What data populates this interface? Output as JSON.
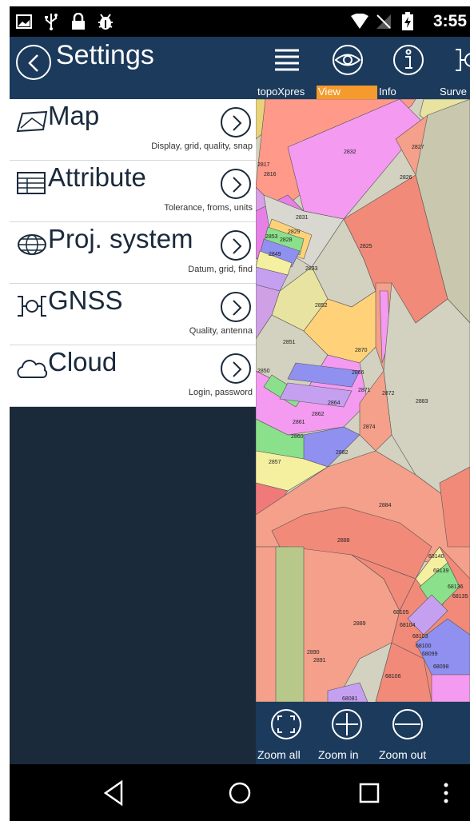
{
  "status_bar": {
    "time": "3:55",
    "icons": [
      "image-icon",
      "usb-icon",
      "lock-icon",
      "android-debug-icon",
      "wifi-icon",
      "no-signal-icon",
      "battery-charging-icon"
    ]
  },
  "settings": {
    "title": "Settings",
    "items": [
      {
        "title": "Map",
        "subtitle": "Display, grid, quality, snap",
        "icon": "map-icon"
      },
      {
        "title": "Attribute",
        "subtitle": "Tolerance, froms, units",
        "icon": "table-icon"
      },
      {
        "title": "Proj. system",
        "subtitle": "Datum, grid, find",
        "icon": "globe-icon"
      },
      {
        "title": "GNSS",
        "subtitle": "Quality, antenna",
        "icon": "gnss-icon"
      },
      {
        "title": "Cloud",
        "subtitle": "Login, password",
        "icon": "cloud-icon"
      }
    ]
  },
  "toolbar": {
    "items": [
      {
        "label": "topoXpres",
        "icon": "menu-icon"
      },
      {
        "label": "View",
        "icon": "eye-icon",
        "active": true
      },
      {
        "label": "Info",
        "icon": "info-icon"
      },
      {
        "label": "Surve",
        "icon": "survey-icon"
      }
    ],
    "accent": "#f59a2c"
  },
  "map": {
    "parcel_labels": [
      "2832",
      "2827",
      "2826",
      "2817",
      "2816",
      "2831",
      "2829",
      "2825",
      "2853",
      "2828",
      "2849",
      "2833",
      "2852",
      "2851",
      "2870",
      "2850",
      "2866",
      "2871",
      "2872",
      "2883",
      "2864",
      "2862",
      "2861",
      "2874",
      "2860",
      "2884",
      "2882",
      "2857",
      "2888",
      "2889",
      "2890",
      "2891",
      "68140",
      "68139",
      "68136",
      "68135",
      "68105",
      "68104",
      "68103",
      "68100",
      "68099",
      "68098",
      "68106",
      "68081"
    ]
  },
  "zoombar": {
    "items": [
      {
        "label": "Zoom all",
        "icon": "zoom-all-icon"
      },
      {
        "label": "Zoom in",
        "icon": "zoom-in-icon"
      },
      {
        "label": "Zoom out",
        "icon": "zoom-out-icon"
      }
    ]
  },
  "colors": {
    "panel": "#1b2a3a",
    "header": "#1b3a5c",
    "accent": "#f59a2c"
  }
}
